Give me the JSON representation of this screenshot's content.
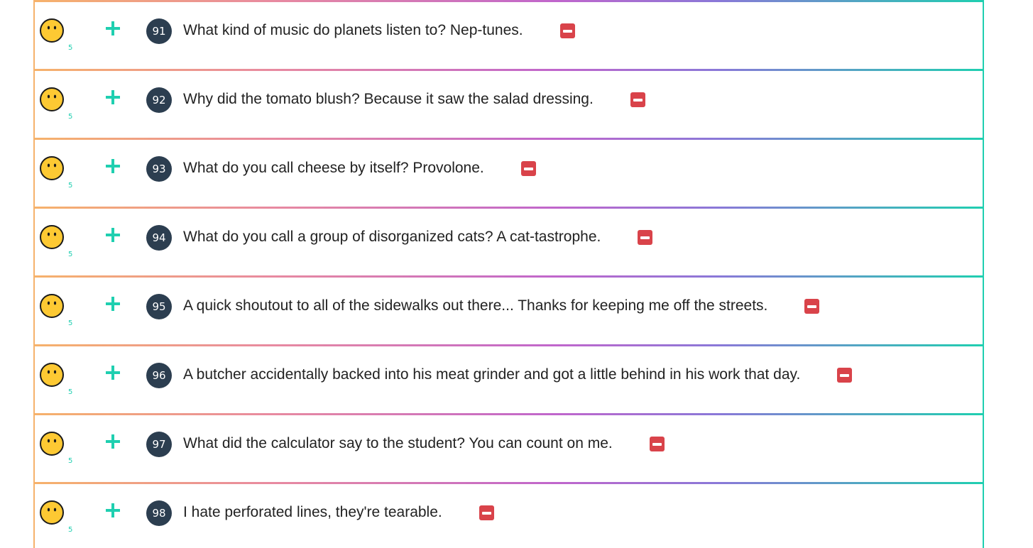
{
  "jokes": [
    {
      "number": "91",
      "text": "What kind of music do planets listen to? Nep-tunes.",
      "score": "5",
      "emoji_icon": "neutral-face-icon"
    },
    {
      "number": "92",
      "text": "Why did the tomato blush? Because it saw the salad dressing.",
      "score": "5",
      "emoji_icon": "neutral-face-icon"
    },
    {
      "number": "93",
      "text": "What do you call cheese by itself? Provolone.",
      "score": "5",
      "emoji_icon": "neutral-face-icon"
    },
    {
      "number": "94",
      "text": "What do you call a group of disorganized cats? A cat-tastrophe.",
      "score": "5",
      "emoji_icon": "neutral-face-icon"
    },
    {
      "number": "95",
      "text": "A quick shoutout to all of the sidewalks out there... Thanks for keeping me off the streets.",
      "score": "5",
      "emoji_icon": "neutral-face-icon"
    },
    {
      "number": "96",
      "text": "A butcher accidentally backed into his meat grinder and got a little behind in his work that day.",
      "score": "5",
      "emoji_icon": "neutral-face-icon"
    },
    {
      "number": "97",
      "text": "What did the calculator say to the student? You can count on me.",
      "score": "5",
      "emoji_icon": "neutral-face-icon"
    },
    {
      "number": "98",
      "text": "I hate perforated lines, they're tearable.",
      "score": "5",
      "emoji_icon": "neutral-face-icon"
    }
  ],
  "colors": {
    "accent": "#1fcfb0",
    "badge_bg": "#2c3e50",
    "remove": "#d9434a",
    "emoji_fill": "#fdc933",
    "border_left": "#f6b26b",
    "border_mid": "#c066cc"
  }
}
